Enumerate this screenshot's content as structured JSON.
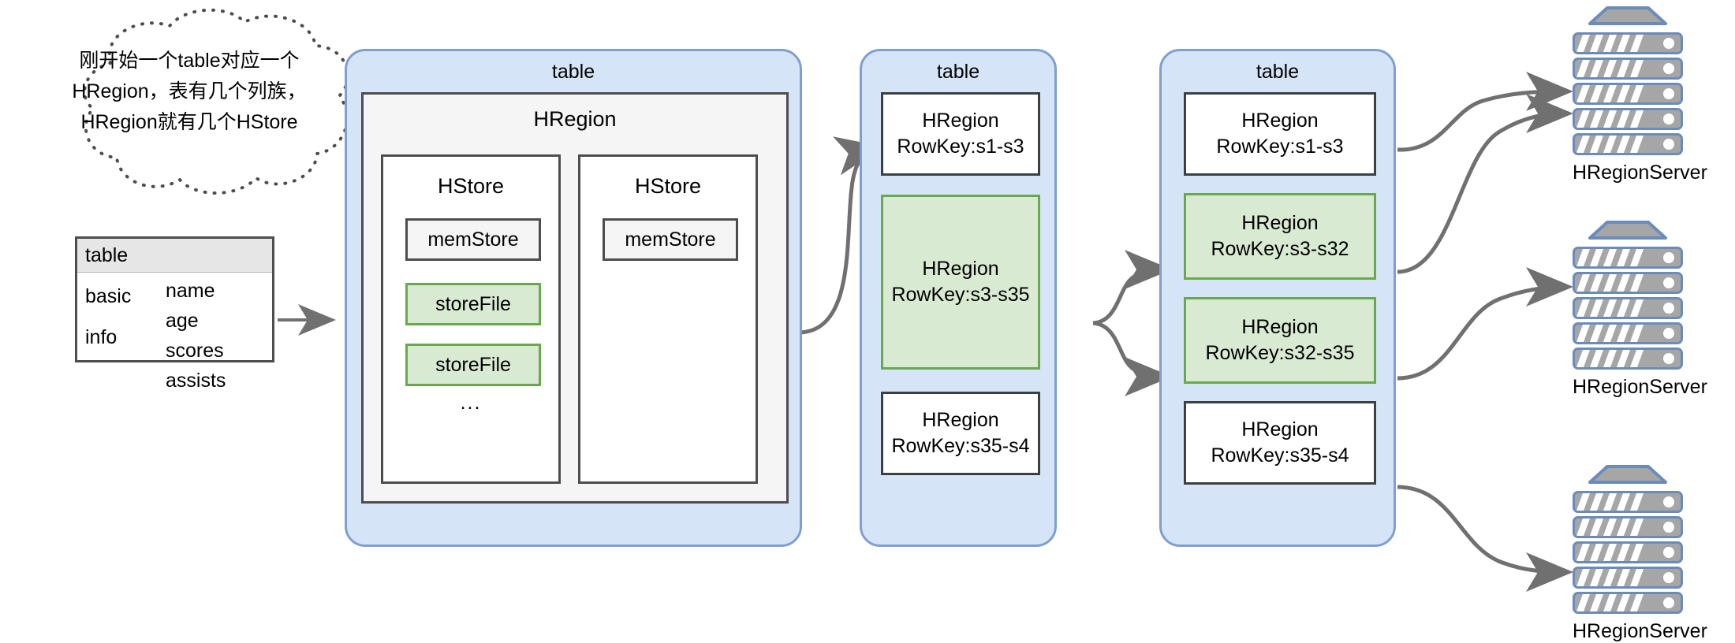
{
  "callout": {
    "name": "cloud-callout",
    "lines": [
      "刚开始一个table对应一个",
      "HRegion，表有几个列族，",
      "HRegion就有几个HStore"
    ]
  },
  "schema": {
    "title": "table",
    "families": [
      "basic",
      "info"
    ],
    "qualifiers": [
      "name",
      "age",
      "scores",
      "assists"
    ]
  },
  "table1": {
    "title": "table",
    "region_title": "HRegion",
    "hstores": [
      {
        "title": "HStore",
        "memstore": "memStore",
        "storefiles": [
          "storeFile",
          "storeFile"
        ],
        "ellipsis": "..."
      },
      {
        "title": "HStore",
        "memstore": "memStore",
        "storefiles": [],
        "ellipsis": ""
      }
    ]
  },
  "table2": {
    "title": "table",
    "regions": [
      {
        "name": "HRegion",
        "rowkey": "RowKey:s1-s3",
        "style": "white"
      },
      {
        "name": "HRegion",
        "rowkey": "RowKey:s3-s35",
        "style": "green"
      },
      {
        "name": "HRegion",
        "rowkey": "RowKey:s35-s4",
        "style": "white"
      }
    ]
  },
  "table3": {
    "title": "table",
    "regions": [
      {
        "name": "HRegion",
        "rowkey": "RowKey:s1-s3",
        "style": "white"
      },
      {
        "name": "HRegion",
        "rowkey": "RowKey:s3-s32",
        "style": "green"
      },
      {
        "name": "HRegion",
        "rowkey": "RowKey:s32-s35",
        "style": "green"
      },
      {
        "name": "HRegion",
        "rowkey": "RowKey:s35-s4",
        "style": "white"
      }
    ]
  },
  "servers": [
    {
      "label": "HRegionServer"
    },
    {
      "label": "HRegionServer"
    },
    {
      "label": "HRegionServer"
    }
  ],
  "colors": {
    "table_fill": "#d6e4f7",
    "table_border": "#7e9fd0",
    "green_fill": "#d9ead3",
    "green_border": "#6aa84f",
    "box_border": "#4d4d4d",
    "arrow": "#707070",
    "server_body": "#a6a6a6",
    "server_border": "#6b8cba"
  }
}
